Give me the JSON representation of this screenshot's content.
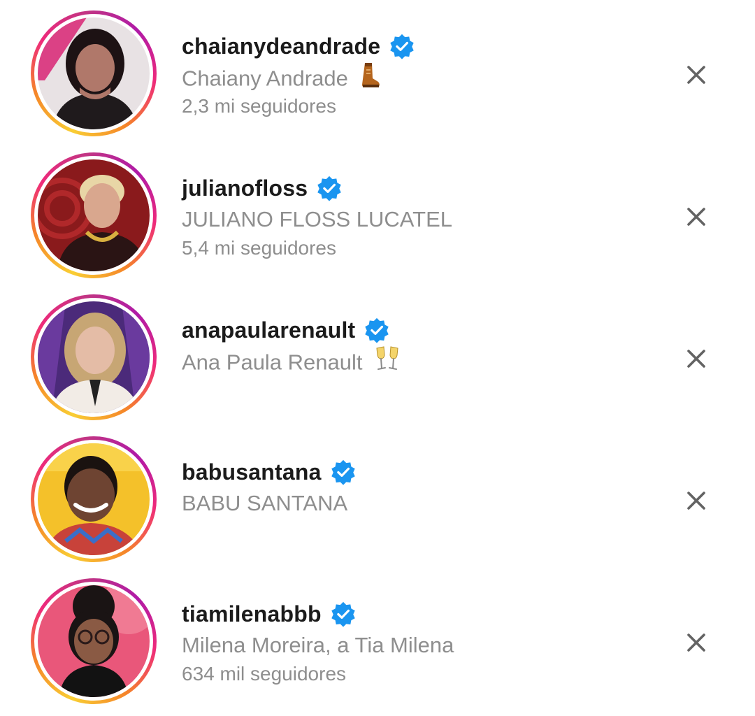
{
  "suggestions": [
    {
      "handle": "chaianydeandrade",
      "full_name": "Chaiany Andrade",
      "emoji": "boot-emoji",
      "followers": "2,3 mi seguidores",
      "verified": true,
      "photo_bg": "#e8e2e4",
      "photo_accent": "#d9307a",
      "hair": "#1d1214",
      "skin": "#b0786a",
      "clothing": "#1f1a1c"
    },
    {
      "handle": "julianofloss",
      "full_name": "JULIANO FLOSS LUCATEL",
      "followers": "5,4 mi seguidores",
      "verified": true,
      "photo_bg": "#8a1a1c",
      "photo_accent": "#b0282a",
      "hair": "#e8d6a6",
      "skin": "#d9a78e",
      "clothing": "#2a1414"
    },
    {
      "handle": "anapaularenault",
      "full_name": "Ana Paula Renault",
      "emoji": "champagne-emoji",
      "verified": true,
      "photo_bg": "#4b2a7a",
      "photo_accent": "#6a3a9e",
      "hair": "#c7a674",
      "skin": "#e4bca6",
      "clothing": "#f2ece6"
    },
    {
      "handle": "babusantana",
      "full_name": "BABU SANTANA",
      "verified": true,
      "photo_bg": "#f4c12a",
      "photo_accent": "#f9d24a",
      "hair": "#1a1210",
      "skin": "#6e4432",
      "clothing": "#c8423a"
    },
    {
      "handle": "tiamilenabbb",
      "full_name": "Milena Moreira, a Tia Milena",
      "followers": "634 mil seguidores",
      "verified": true,
      "photo_bg": "#e9577a",
      "photo_accent": "#f07a93",
      "hair": "#1a1414",
      "skin": "#8a5a44",
      "clothing": "#121212"
    }
  ],
  "colors": {
    "verified_blue": "#1a95f0",
    "text_primary": "#1b1b1b",
    "text_secondary": "#8e8e8e",
    "close_icon": "#636363"
  }
}
